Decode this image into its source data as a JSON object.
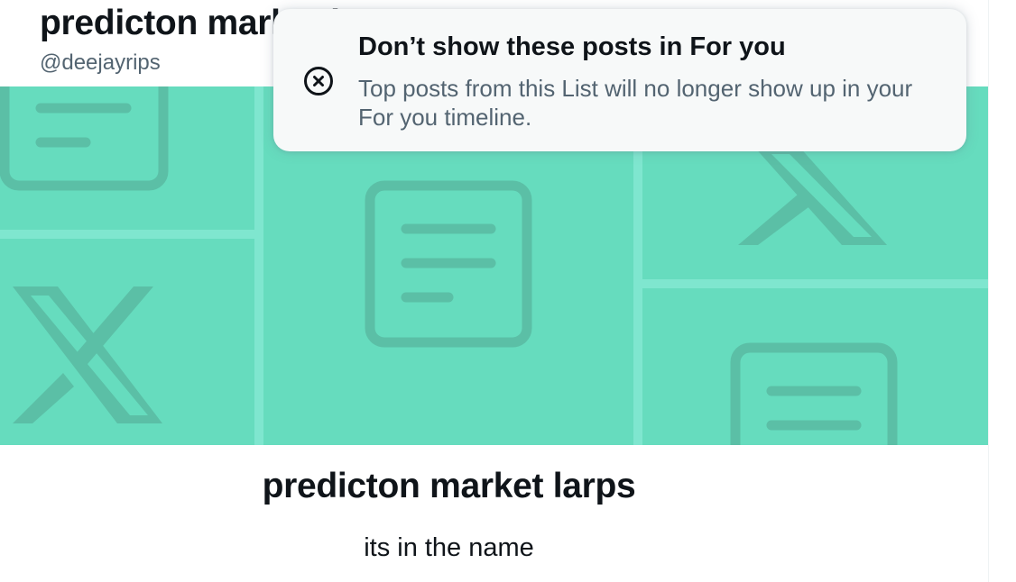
{
  "header": {
    "title": "predicton market larps",
    "handle": "@deejayrips"
  },
  "banner": {
    "background_color": "#66dcbe",
    "icons": [
      "document-icon",
      "x-logo-icon"
    ]
  },
  "list": {
    "name": "predicton market larps",
    "description": "its in the name"
  },
  "popup_menu": {
    "item": {
      "icon": "close-circle-icon",
      "title": "Don’t show these posts in For you",
      "description": "Top posts from this List will no longer show up in your For you timeline."
    }
  }
}
